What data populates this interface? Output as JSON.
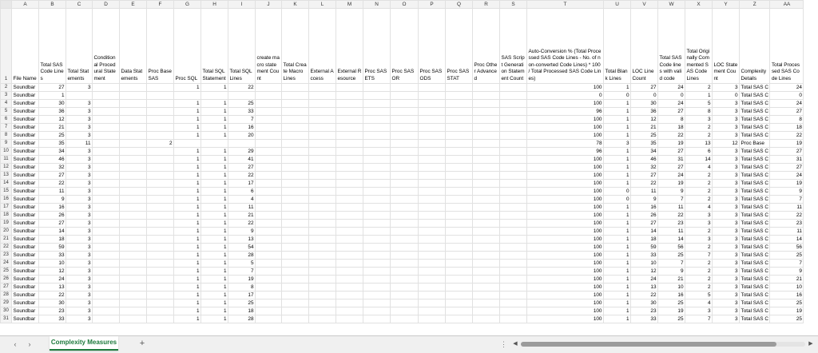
{
  "columns": [
    "A",
    "B",
    "C",
    "D",
    "E",
    "F",
    "G",
    "H",
    "I",
    "J",
    "K",
    "L",
    "M",
    "N",
    "O",
    "P",
    "Q",
    "R",
    "S",
    "T",
    "U",
    "V",
    "W",
    "X",
    "Y",
    "Z",
    "AA"
  ],
  "header_row_number": "1",
  "headers": [
    "File Name",
    "Total SAS Code Lines",
    "Total Statements",
    "Conditional Procedural Statement",
    "Data Statements",
    "Proc Base SAS",
    "Proc SQL",
    "Total SQL Statement",
    "Total SQL Lines",
    "create macro statement Count",
    "Total Create Macro Lines",
    "External Access",
    "External Resource",
    "Proc SAS ETS",
    "Proc SAS OR",
    "Proc SAS ODS",
    "Proc SAS STAT",
    "Proc Other Advanced",
    "SAS Script Generation Statement Count",
    "Auto-Conversion % (Total Processed SAS Code Lines - No. of non-converted Code Lines) * 100 / Total Processed SAS Code Lines)",
    "Total Blank Lines",
    "LOC Line Count",
    "Total SAS Code lines with valid code",
    "Total Originally Commented SAS Code Lines",
    "LOC Statement Count",
    "Complexity Details",
    "Total Processed SAS Code Lines"
  ],
  "rows": [
    {
      "n": "2",
      "c": [
        "Soundbar",
        "27",
        "3",
        "",
        "",
        "",
        "1",
        "1",
        "22",
        "",
        "",
        "",
        "",
        "",
        "",
        "",
        "",
        "",
        "",
        "100",
        "1",
        "27",
        "24",
        "2",
        "3",
        "Total SAS C",
        "24"
      ]
    },
    {
      "n": "3",
      "c": [
        "Soundbar",
        "1",
        "",
        "",
        "",
        "",
        "",
        "",
        "",
        "",
        "",
        "",
        "",
        "",
        "",
        "",
        "",
        "",
        "",
        "0",
        "0",
        "0",
        "0",
        "1",
        "0",
        "Total SAS C",
        "0"
      ]
    },
    {
      "n": "4",
      "c": [
        "Soundbar",
        "30",
        "3",
        "",
        "",
        "",
        "1",
        "1",
        "25",
        "",
        "",
        "",
        "",
        "",
        "",
        "",
        "",
        "",
        "",
        "100",
        "1",
        "30",
        "24",
        "5",
        "3",
        "Total SAS C",
        "24"
      ]
    },
    {
      "n": "5",
      "c": [
        "Soundbar",
        "36",
        "3",
        "",
        "",
        "",
        "1",
        "1",
        "33",
        "",
        "",
        "",
        "",
        "",
        "",
        "",
        "",
        "",
        "",
        "96",
        "1",
        "36",
        "27",
        "8",
        "3",
        "Total SAS C",
        "27"
      ]
    },
    {
      "n": "6",
      "c": [
        "Soundbar",
        "12",
        "3",
        "",
        "",
        "",
        "1",
        "1",
        "7",
        "",
        "",
        "",
        "",
        "",
        "",
        "",
        "",
        "",
        "",
        "100",
        "1",
        "12",
        "8",
        "3",
        "3",
        "Total SAS C",
        "8"
      ]
    },
    {
      "n": "7",
      "c": [
        "Soundbar",
        "21",
        "3",
        "",
        "",
        "",
        "1",
        "1",
        "16",
        "",
        "",
        "",
        "",
        "",
        "",
        "",
        "",
        "",
        "",
        "100",
        "1",
        "21",
        "18",
        "2",
        "3",
        "Total SAS C",
        "18"
      ]
    },
    {
      "n": "8",
      "c": [
        "Soundbar",
        "25",
        "3",
        "",
        "",
        "",
        "1",
        "1",
        "20",
        "",
        "",
        "",
        "",
        "",
        "",
        "",
        "",
        "",
        "",
        "100",
        "1",
        "25",
        "22",
        "2",
        "3",
        "Total SAS C",
        "22"
      ]
    },
    {
      "n": "9",
      "c": [
        "Soundbar",
        "35",
        "11",
        "",
        "",
        "2",
        "",
        "",
        "",
        "",
        "",
        "",
        "",
        "",
        "",
        "",
        "",
        "",
        "",
        "78",
        "3",
        "35",
        "19",
        "13",
        "12",
        "Proc Base",
        "19"
      ]
    },
    {
      "n": "10",
      "c": [
        "Soundbar",
        "34",
        "3",
        "",
        "",
        "",
        "1",
        "1",
        "29",
        "",
        "",
        "",
        "",
        "",
        "",
        "",
        "",
        "",
        "",
        "96",
        "1",
        "34",
        "27",
        "6",
        "3",
        "Total SAS C",
        "27"
      ]
    },
    {
      "n": "11",
      "c": [
        "Soundbar",
        "46",
        "3",
        "",
        "",
        "",
        "1",
        "1",
        "41",
        "",
        "",
        "",
        "",
        "",
        "",
        "",
        "",
        "",
        "",
        "100",
        "1",
        "46",
        "31",
        "14",
        "3",
        "Total SAS C",
        "31"
      ]
    },
    {
      "n": "12",
      "c": [
        "Soundbar",
        "32",
        "3",
        "",
        "",
        "",
        "1",
        "1",
        "27",
        "",
        "",
        "",
        "",
        "",
        "",
        "",
        "",
        "",
        "",
        "100",
        "1",
        "32",
        "27",
        "4",
        "3",
        "Total SAS C",
        "27"
      ]
    },
    {
      "n": "13",
      "c": [
        "Soundbar",
        "27",
        "3",
        "",
        "",
        "",
        "1",
        "1",
        "22",
        "",
        "",
        "",
        "",
        "",
        "",
        "",
        "",
        "",
        "",
        "100",
        "1",
        "27",
        "24",
        "2",
        "3",
        "Total SAS C",
        "24"
      ]
    },
    {
      "n": "14",
      "c": [
        "Soundbar",
        "22",
        "3",
        "",
        "",
        "",
        "1",
        "1",
        "17",
        "",
        "",
        "",
        "",
        "",
        "",
        "",
        "",
        "",
        "",
        "100",
        "1",
        "22",
        "19",
        "2",
        "3",
        "Total SAS C",
        "19"
      ]
    },
    {
      "n": "15",
      "c": [
        "Soundbar",
        "11",
        "3",
        "",
        "",
        "",
        "1",
        "1",
        "6",
        "",
        "",
        "",
        "",
        "",
        "",
        "",
        "",
        "",
        "",
        "100",
        "0",
        "11",
        "9",
        "2",
        "3",
        "Total SAS C",
        "9"
      ]
    },
    {
      "n": "16",
      "c": [
        "Soundbar",
        "9",
        "3",
        "",
        "",
        "",
        "1",
        "1",
        "4",
        "",
        "",
        "",
        "",
        "",
        "",
        "",
        "",
        "",
        "",
        "100",
        "0",
        "9",
        "7",
        "2",
        "3",
        "Total SAS C",
        "7"
      ]
    },
    {
      "n": "17",
      "c": [
        "Soundbar",
        "16",
        "3",
        "",
        "",
        "",
        "1",
        "1",
        "11",
        "",
        "",
        "",
        "",
        "",
        "",
        "",
        "",
        "",
        "",
        "100",
        "1",
        "16",
        "11",
        "4",
        "3",
        "Total SAS C",
        "11"
      ]
    },
    {
      "n": "18",
      "c": [
        "Soundbar",
        "26",
        "3",
        "",
        "",
        "",
        "1",
        "1",
        "21",
        "",
        "",
        "",
        "",
        "",
        "",
        "",
        "",
        "",
        "",
        "100",
        "1",
        "26",
        "22",
        "3",
        "3",
        "Total SAS C",
        "22"
      ]
    },
    {
      "n": "19",
      "c": [
        "Soundbar",
        "27",
        "3",
        "",
        "",
        "",
        "1",
        "1",
        "22",
        "",
        "",
        "",
        "",
        "",
        "",
        "",
        "",
        "",
        "",
        "100",
        "1",
        "27",
        "23",
        "3",
        "3",
        "Total SAS C",
        "23"
      ]
    },
    {
      "n": "20",
      "c": [
        "Soundbar",
        "14",
        "3",
        "",
        "",
        "",
        "1",
        "1",
        "9",
        "",
        "",
        "",
        "",
        "",
        "",
        "",
        "",
        "",
        "",
        "100",
        "1",
        "14",
        "11",
        "2",
        "3",
        "Total SAS C",
        "11"
      ]
    },
    {
      "n": "21",
      "c": [
        "Soundbar",
        "18",
        "3",
        "",
        "",
        "",
        "1",
        "1",
        "13",
        "",
        "",
        "",
        "",
        "",
        "",
        "",
        "",
        "",
        "",
        "100",
        "1",
        "18",
        "14",
        "3",
        "3",
        "Total SAS C",
        "14"
      ]
    },
    {
      "n": "22",
      "c": [
        "Soundbar",
        "59",
        "3",
        "",
        "",
        "",
        "1",
        "1",
        "54",
        "",
        "",
        "",
        "",
        "",
        "",
        "",
        "",
        "",
        "",
        "100",
        "1",
        "59",
        "56",
        "2",
        "3",
        "Total SAS C",
        "56"
      ]
    },
    {
      "n": "23",
      "c": [
        "Soundbar",
        "33",
        "3",
        "",
        "",
        "",
        "1",
        "1",
        "28",
        "",
        "",
        "",
        "",
        "",
        "",
        "",
        "",
        "",
        "",
        "100",
        "1",
        "33",
        "25",
        "7",
        "3",
        "Total SAS C",
        "25"
      ]
    },
    {
      "n": "24",
      "c": [
        "Soundbar",
        "10",
        "3",
        "",
        "",
        "",
        "1",
        "1",
        "5",
        "",
        "",
        "",
        "",
        "",
        "",
        "",
        "",
        "",
        "",
        "100",
        "1",
        "10",
        "7",
        "2",
        "3",
        "Total SAS C",
        "7"
      ]
    },
    {
      "n": "25",
      "c": [
        "Soundbar",
        "12",
        "3",
        "",
        "",
        "",
        "1",
        "1",
        "7",
        "",
        "",
        "",
        "",
        "",
        "",
        "",
        "",
        "",
        "",
        "100",
        "1",
        "12",
        "9",
        "2",
        "3",
        "Total SAS C",
        "9"
      ]
    },
    {
      "n": "26",
      "c": [
        "Soundbar",
        "24",
        "3",
        "",
        "",
        "",
        "1",
        "1",
        "19",
        "",
        "",
        "",
        "",
        "",
        "",
        "",
        "",
        "",
        "",
        "100",
        "1",
        "24",
        "21",
        "2",
        "3",
        "Total SAS C",
        "21"
      ]
    },
    {
      "n": "27",
      "c": [
        "Soundbar",
        "13",
        "3",
        "",
        "",
        "",
        "1",
        "1",
        "8",
        "",
        "",
        "",
        "",
        "",
        "",
        "",
        "",
        "",
        "",
        "100",
        "1",
        "13",
        "10",
        "2",
        "3",
        "Total SAS C",
        "10"
      ]
    },
    {
      "n": "28",
      "c": [
        "Soundbar",
        "22",
        "3",
        "",
        "",
        "",
        "1",
        "1",
        "17",
        "",
        "",
        "",
        "",
        "",
        "",
        "",
        "",
        "",
        "",
        "100",
        "1",
        "22",
        "16",
        "5",
        "3",
        "Total SAS C",
        "16"
      ]
    },
    {
      "n": "29",
      "c": [
        "Soundbar",
        "30",
        "3",
        "",
        "",
        "",
        "1",
        "1",
        "25",
        "",
        "",
        "",
        "",
        "",
        "",
        "",
        "",
        "",
        "",
        "100",
        "1",
        "30",
        "25",
        "4",
        "3",
        "Total SAS C",
        "25"
      ]
    },
    {
      "n": "30",
      "c": [
        "Soundbar",
        "23",
        "3",
        "",
        "",
        "",
        "1",
        "1",
        "18",
        "",
        "",
        "",
        "",
        "",
        "",
        "",
        "",
        "",
        "",
        "100",
        "1",
        "23",
        "19",
        "3",
        "3",
        "Total SAS C",
        "19"
      ]
    },
    {
      "n": "31",
      "c": [
        "Soundbar",
        "33",
        "3",
        "",
        "",
        "",
        "1",
        "1",
        "28",
        "",
        "",
        "",
        "",
        "",
        "",
        "",
        "",
        "",
        "",
        "100",
        "1",
        "33",
        "25",
        "7",
        "3",
        "Total SAS C",
        "25"
      ]
    }
  ],
  "sheet_tab": "Complexity Measures",
  "add_sheet_symbol": "+",
  "nav_prev_symbol": "‹",
  "nav_next_symbol": "›",
  "more_options_symbol": "⋮",
  "scroll_left_symbol": "◀",
  "scroll_right_symbol": "▶"
}
